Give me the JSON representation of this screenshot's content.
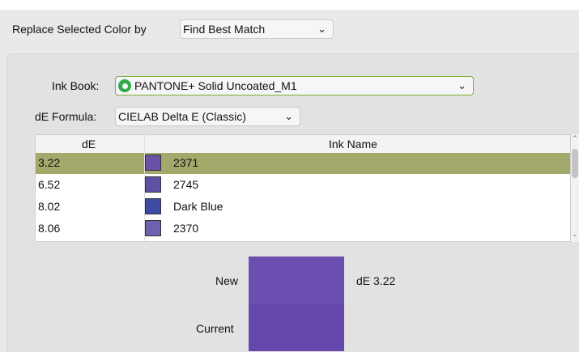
{
  "replace": {
    "label": "Replace Selected Color by",
    "selected": "Find Best Match"
  },
  "ink_book": {
    "label": "Ink Book:",
    "selected": "PANTONE+ Solid Uncoated_M1"
  },
  "de_formula": {
    "label": "dE Formula:",
    "selected": "CIELAB Delta E (Classic)"
  },
  "table": {
    "columns": [
      "dE",
      "Ink Name"
    ],
    "rows": [
      {
        "de": "3.22",
        "name": "2371",
        "color": "#6b52a8",
        "selected": true
      },
      {
        "de": "6.52",
        "name": "2745",
        "color": "#5d51a3",
        "selected": false
      },
      {
        "de": "8.02",
        "name": "Dark Blue",
        "color": "#3f4aa4",
        "selected": false
      },
      {
        "de": "8.06",
        "name": "2370",
        "color": "#7060b0",
        "selected": false
      }
    ]
  },
  "preview": {
    "new_label": "New",
    "current_label": "Current",
    "de_text": "dE 3.22",
    "new_color": "#6a4fb0",
    "current_color": "#6647ae"
  },
  "colors": {
    "selected_row": "#a3a86b",
    "ink_book_border": "#7cad3a",
    "pantone_icon": "#2faa4a"
  }
}
